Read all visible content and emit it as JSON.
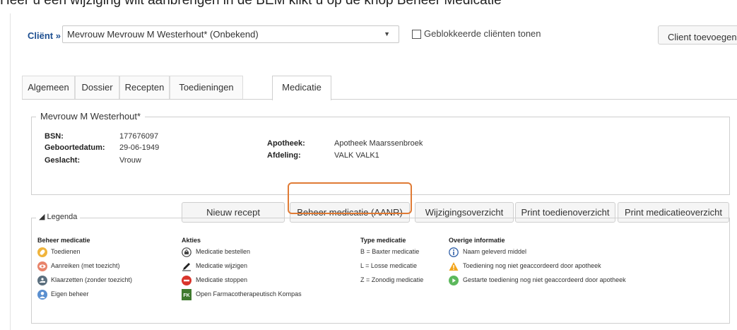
{
  "doc_text": "Heer u een wijziging wilt aanbrengen in de BEM klikt u op de knop Beheer Medicatie",
  "client": {
    "label": "Cliënt",
    "arrow": "»",
    "selected": "Mevrouw Mevrouw M Westerhout* (Onbekend)",
    "blocked_label": "Geblokkeerde cliënten tonen",
    "add_button": "Client toevoegen"
  },
  "tabs": [
    "Algemeen",
    "Dossier",
    "Recepten",
    "Toedieningen",
    "Medicatie"
  ],
  "active_tab": "Medicatie",
  "patient": {
    "name": "Mevrouw M Westerhout*",
    "bsn_label": "BSN:",
    "bsn": "177676097",
    "dob_label": "Geboortedatum:",
    "dob": "29-06-1949",
    "gender_label": "Geslacht:",
    "gender": "Vrouw",
    "pharmacy_label": "Apotheek:",
    "pharmacy": "Apotheek Maarssenbroek",
    "department_label": "Afdeling:",
    "department": "VALK VALK1"
  },
  "actions": {
    "new_recipe": "Nieuw recept",
    "manage": "Beheer medicatie (AANR)",
    "changes": "Wijzigingsoverzicht",
    "print_admin": "Print toedienoverzicht",
    "print_med": "Print medicatieoverzicht"
  },
  "legenda": {
    "title": "◢ Legenda",
    "beheer": {
      "head": "Beheer medicatie",
      "items": [
        "Toedienen",
        "Aanreiken (met toezicht)",
        "Klaarzetten (zonder toezicht)",
        "Eigen beheer"
      ]
    },
    "akties": {
      "head": "Akties",
      "items": [
        "Medicatie bestellen",
        "Medicatie wijzigen",
        "Medicatie stoppen",
        "Open Farmacotherapeutisch Kompas"
      ]
    },
    "type": {
      "head": "Type medicatie",
      "items": [
        "B = Baxter medicatie",
        "L = Losse medicatie",
        "Z = Zonodig medicatie"
      ]
    },
    "overig": {
      "head": "Overige informatie",
      "items": [
        "Naam geleverd middel",
        "Toediening nog niet geaccordeerd door apotheek",
        "Gestarte toediening nog niet geaccordeerd door apotheek"
      ]
    },
    "fk_icon_text": "FK"
  },
  "colors": {
    "accent": "#e07b35",
    "client_label": "#1d4f91"
  }
}
